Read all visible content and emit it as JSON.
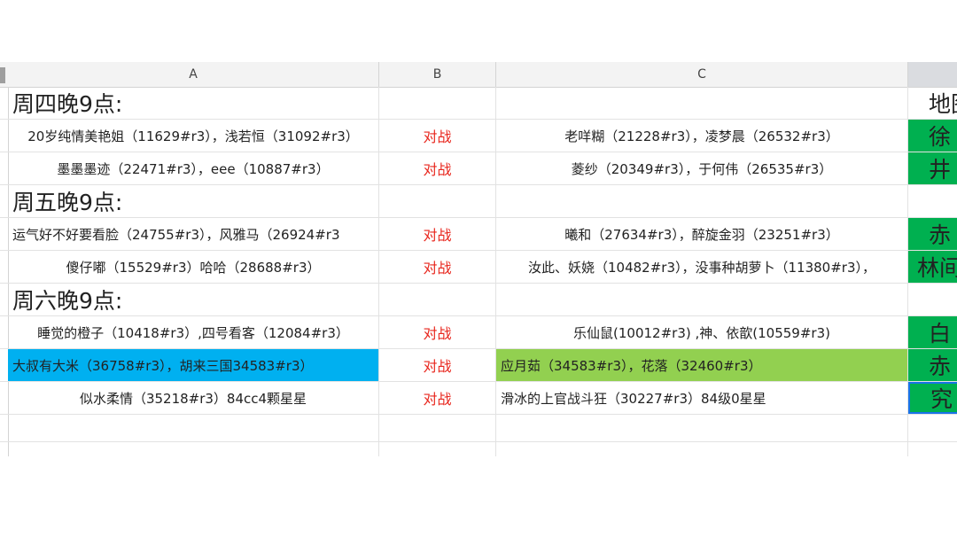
{
  "columns": {
    "a": "A",
    "b": "B",
    "c": "C",
    "d": ""
  },
  "colors": {
    "blue_fill": "#00b0f0",
    "lightgreen_fill": "#92d050",
    "green_fill": "#00b050",
    "header_bg": "#f3f3f3",
    "red_text": "#e8261d"
  },
  "rows": {
    "r1": {
      "a": "周四晚9点:",
      "b": "",
      "c": "",
      "d": "地图"
    },
    "r2": {
      "a": "20岁纯情美艳姐（11629#r3），浅若恒（31092#r3）",
      "b": "对战",
      "c": "老咩糊（21228#r3），凌梦晨（26532#r3）",
      "d": "徐"
    },
    "r3": {
      "a": "墨墨墨迹（22471#r3），eee（10887#r3）",
      "b": "对战",
      "c": "菱纱（20349#r3），于何伟（26535#r3）",
      "d": "井"
    },
    "r4": {
      "a": "周五晚9点:",
      "b": "",
      "c": "",
      "d": ""
    },
    "r5": {
      "a": "运气好不好要看脸（24755#r3），风雅马（26924#r3",
      "b": "对战",
      "c": "曦和（27634#r3），醉旋金羽（23251#r3）",
      "d": "赤"
    },
    "r6": {
      "a": "傻仔嘟（15529#r3）哈哈（28688#r3）",
      "b": "对战",
      "c": "汝此、妖娆（10482#r3），没事种胡萝卜（11380#r3），",
      "d": "林间"
    },
    "r7": {
      "a": "周六晚9点:",
      "b": "",
      "c": "",
      "d": ""
    },
    "r8": {
      "a": "睡觉的橙子（10418#r3）,四号看客（12084#r3）",
      "b": "对战",
      "c": "乐仙鼠(10012#r3) ,神、依歆(10559#r3)",
      "d": "白"
    },
    "r9": {
      "a": "大叔有大米（36758#r3），胡来三国34583#r3）",
      "b": "对战",
      "c": "应月茹（34583#r3），花落（32460#r3）",
      "d": "赤"
    },
    "r10": {
      "a": "似水柔情（35218#r3）84cc4颗星星",
      "b": "对战",
      "c": "滑冰的上官战斗狂（30227#r3）84级0星星",
      "d": "究"
    }
  }
}
